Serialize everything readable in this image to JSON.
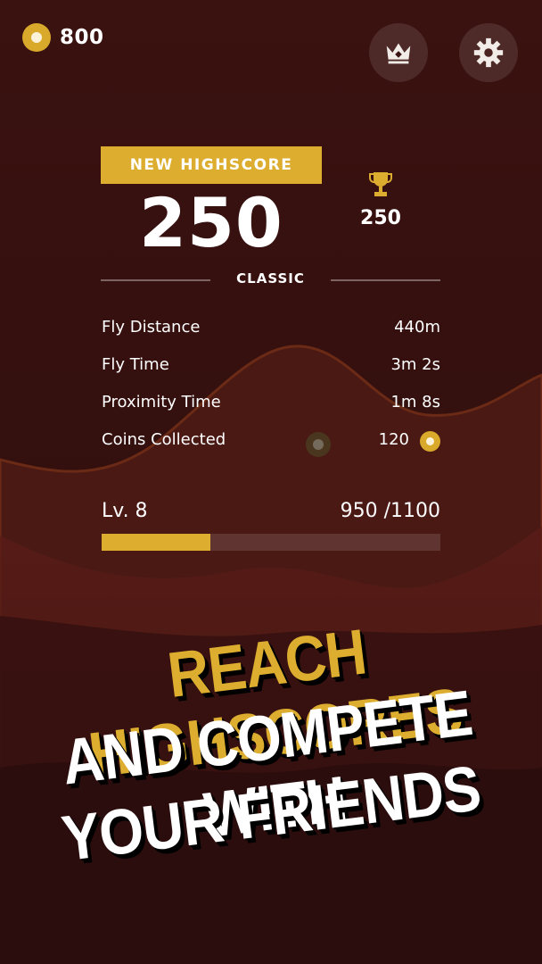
{
  "colors": {
    "accent": "#dcad2f",
    "background": "#2a0c0b",
    "text": "#ffffff"
  },
  "top_bar": {
    "coins": "800",
    "coin_icon": "coin-icon",
    "leaderboard_icon": "crown-icon",
    "settings_icon": "gear-icon"
  },
  "results": {
    "badge": "NEW HIGHSCORE",
    "score": "250",
    "best_score": "250",
    "mode": "CLASSIC",
    "stats": [
      {
        "label": "Fly Distance",
        "value": "440m"
      },
      {
        "label": "Fly Time",
        "value": "3m 2s"
      },
      {
        "label": "Proximity Time",
        "value": "1m 8s"
      },
      {
        "label": "Coins Collected",
        "value": "120"
      }
    ]
  },
  "level": {
    "label": "Lv. 8",
    "xp_current": "950",
    "xp_max": "1100",
    "xp_text": "950 /1100",
    "progress_fraction": 0.32
  },
  "promo": {
    "line1": "REACH HIGHSCORES",
    "line2": "AND COMPETE WITH",
    "line3": "YOUR FRIENDS"
  }
}
